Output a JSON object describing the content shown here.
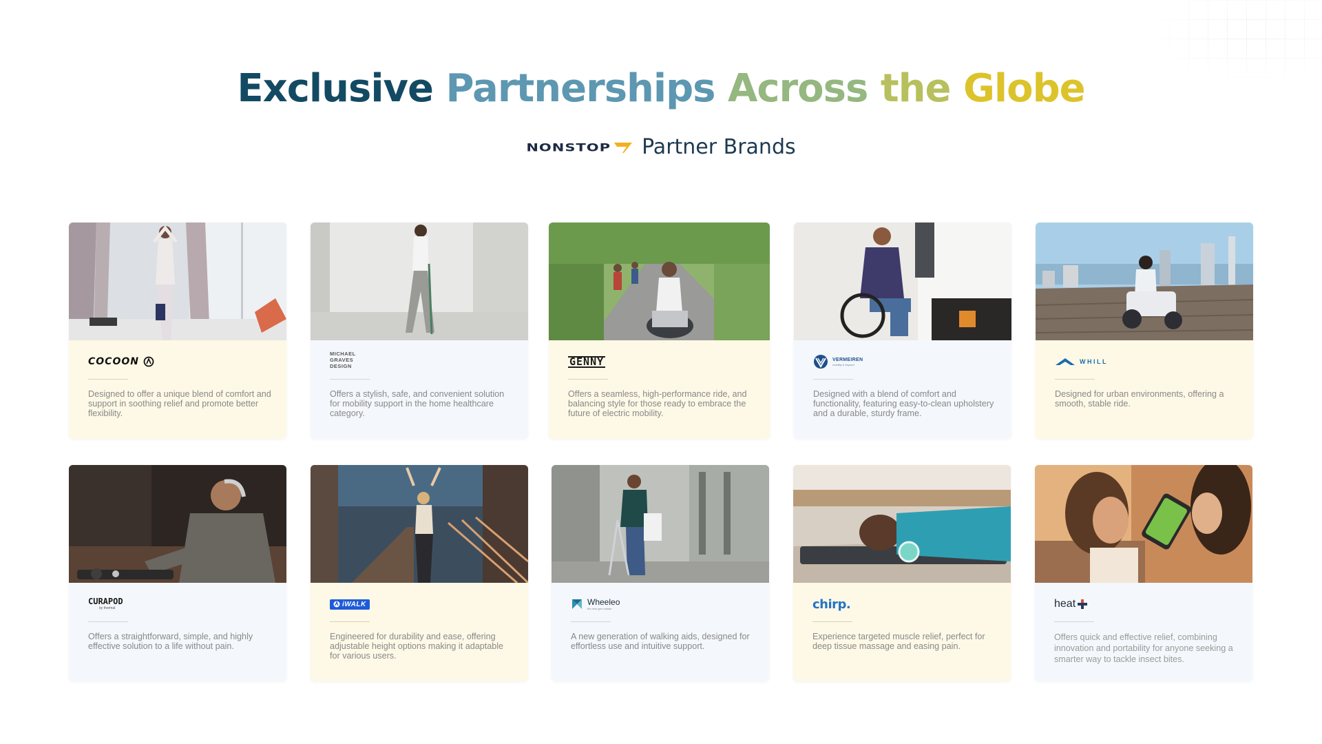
{
  "heading": {
    "word1": "Exclusive",
    "word2": "Partnerships",
    "word3": "Across",
    "word4": "the",
    "word5": "Globe"
  },
  "subheading": {
    "brand_logo": "NONSTOP",
    "text": "Partner Brands"
  },
  "colors": {
    "heading_dark": "#134a63",
    "heading_mid": "#5d97b1",
    "heading_green": "#95b780",
    "heading_yellow": "#dcc32b",
    "card_yellow": "#fdf9e6",
    "card_blue": "#f4f7fb",
    "nonstop_accent": "#f2b01e",
    "ewalk_blue": "#1e5bd8",
    "chirp_blue": "#2474c4"
  },
  "cards": [
    {
      "logo": "COCOON",
      "logo_icon": "cocoon-symbol-icon",
      "description": "Designed to offer a unique blend of comfort and support in soothing relief and promote better flexibility."
    },
    {
      "logo_line1": "MICHAEL",
      "logo_line2": "GRAVES",
      "logo_line3": "DESIGN",
      "description": "Offers a stylish, safe, and convenient solution for mobility support in the home healthcare category."
    },
    {
      "logo": "GENNY",
      "description": "Offers a seamless, high-performance ride, and balancing style for those ready to embrace the future of electric mobility."
    },
    {
      "logo": "VERMEIREN",
      "logo_sub": "mobility & beyond",
      "logo_icon": "vermeiren-globe-icon",
      "description": "Designed with a blend of comfort and functionality, featuring easy-to-clean upholstery and a durable, sturdy frame."
    },
    {
      "logo": "WHILL",
      "logo_icon": "whill-chevron-icon",
      "description": "Designed for urban environments, offering a smooth, stable ride."
    },
    {
      "logo": "CURAPOD",
      "logo_sub": "by thermal",
      "description": "Offers a straightforward, simple, and highly effective solution to a life without pain."
    },
    {
      "logo": "iWALK",
      "logo_icon": "iwalk-badge-icon",
      "description": "Engineered for durability and ease, offering adjustable height options making it adaptable for various users."
    },
    {
      "logo": "Wheeleo",
      "logo_sub": "the next gen rollator",
      "logo_icon": "wheeleo-symbol-icon",
      "description": "A new generation of walking aids, designed for effortless use and intuitive support."
    },
    {
      "logo": "chirp.",
      "description": "Experience targeted muscle relief, perfect for deep tissue massage and easing pain."
    },
    {
      "logo": "heat",
      "logo_icon": "heat-plus-icon",
      "description": "Offers quick and effective relief, combining innovation and portability for anyone seeking a smarter way to tackle insect bites."
    }
  ]
}
